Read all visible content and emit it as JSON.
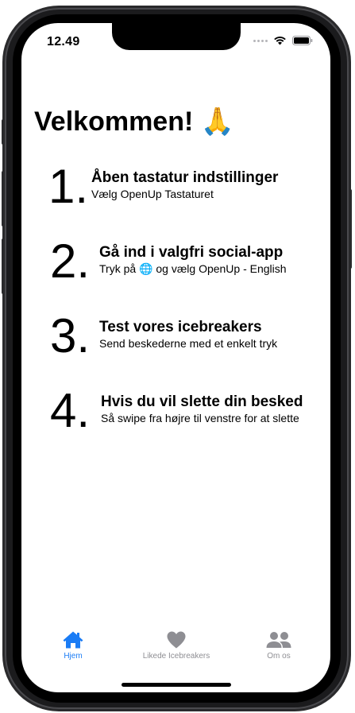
{
  "status_bar": {
    "time": "12.49"
  },
  "main": {
    "title": "Velkommen! 🙏",
    "steps": [
      {
        "number": "1.",
        "title": "Åben tastatur indstillinger",
        "subtitle": "Vælg OpenUp Tastaturet"
      },
      {
        "number": "2.",
        "title": "Gå ind i valgfri social-app",
        "subtitle": "Tryk på 🌐 og vælg OpenUp - English"
      },
      {
        "number": "3.",
        "title": "Test vores icebreakers",
        "subtitle": "Send beskederne med et enkelt tryk"
      },
      {
        "number": "4.",
        "title": "Hvis du vil slette din besked",
        "subtitle": "Så swipe fra højre til venstre for at slette"
      }
    ]
  },
  "tab_bar": {
    "tabs": [
      {
        "label": "Hjem",
        "icon": "house-icon",
        "active": true
      },
      {
        "label": "Likede Icebreakers",
        "icon": "heart-icon",
        "active": false
      },
      {
        "label": "Om os",
        "icon": "people-icon",
        "active": false
      }
    ]
  },
  "colors": {
    "accent": "#1a7cf5",
    "inactive": "#8e8e93"
  }
}
